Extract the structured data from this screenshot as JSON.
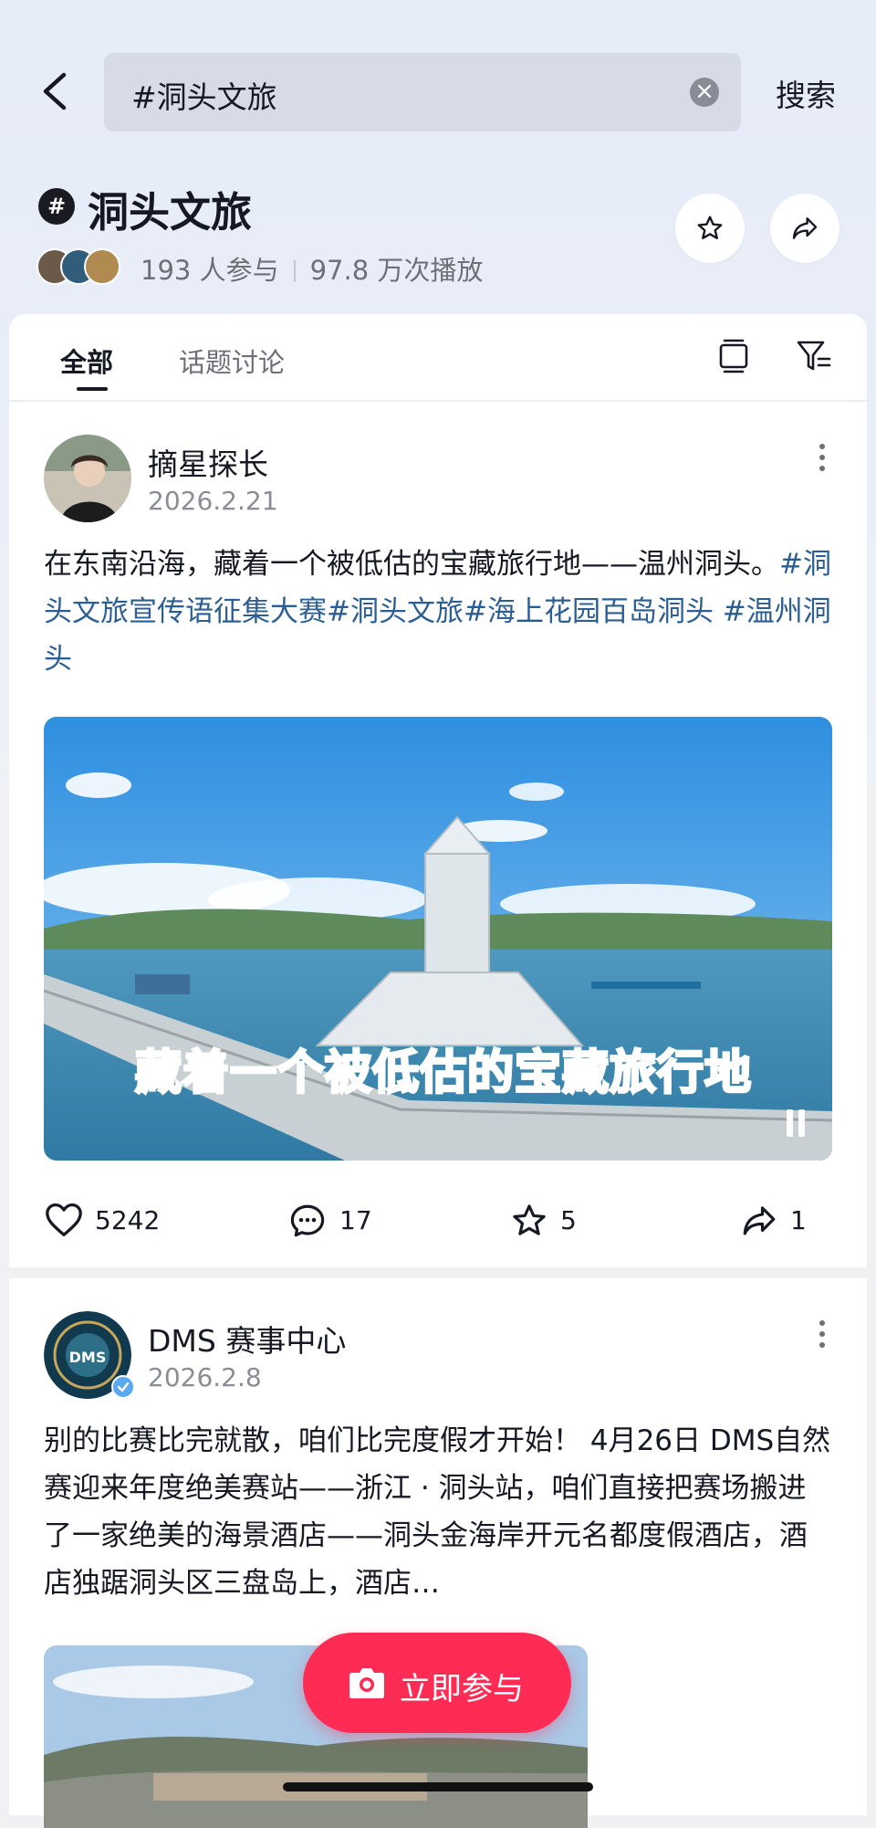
{
  "search": {
    "query": "#洞头文旅",
    "button_label": "搜索"
  },
  "topic": {
    "icon_glyph": "#",
    "title": "洞头文旅",
    "participants": "193 人参与",
    "plays": "97.8 万次播放"
  },
  "tabs": [
    {
      "label": "全部",
      "active": true
    },
    {
      "label": "话题讨论",
      "active": false
    }
  ],
  "posts": [
    {
      "author": "摘星探长",
      "date": "2026.2.21",
      "text": "在东南沿海，藏着一个被低估的宝藏旅行地——温州洞头。",
      "tags": "#洞头文旅宣传语征集大赛#洞头文旅#海上花园百岛洞头 #温州洞头",
      "video_caption": "藏着一个被低估的宝藏旅行地",
      "likes": "5242",
      "comments": "17",
      "favorites": "5",
      "shares": "1"
    },
    {
      "author": "DMS 赛事中心",
      "date": "2026.2.8",
      "text": "别的比赛比完就散，咱们比完度假才开始！ 4月26日 DMS自然赛迎来年度绝美赛站——浙江 · 洞头站，咱们直接把赛场搬进了一家绝美的海景酒店——洞头金海岸开元名都度假酒店，酒店独踞洞头区三盘岛上，酒店…"
    }
  ],
  "join_button": {
    "label": "立即参与"
  },
  "colors": {
    "accent": "#fe2c55",
    "tag": "#2b5e92"
  },
  "icons": [
    "back-icon",
    "clear-icon",
    "star-icon",
    "share-icon",
    "list-icon",
    "filter-icon",
    "more-icon",
    "heart-icon",
    "comment-icon",
    "camera-icon",
    "pause-icon",
    "verified-icon"
  ]
}
